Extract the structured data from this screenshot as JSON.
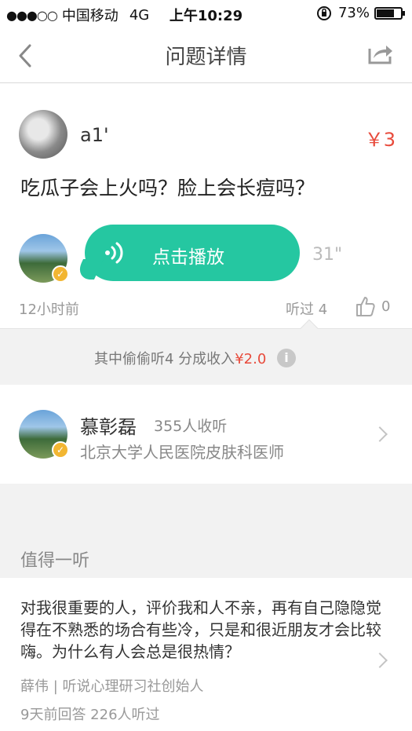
{
  "status_bar": {
    "signal_dots": "●●●○○",
    "carrier": "中国移动",
    "network": "4G",
    "time": "上午10:29",
    "battery_percent": "73%",
    "battery_level": 0.73
  },
  "nav": {
    "title": "问题详情"
  },
  "question": {
    "asker_name": "a1'",
    "price": "￥3",
    "text": "吃瓜子会上火吗？脸上会长痘吗？"
  },
  "answer": {
    "play_label": "点击播放",
    "duration": "31\"",
    "posted": "12小时前",
    "heard": "听过 4",
    "likes": "0"
  },
  "income": {
    "prefix": "其中偷偷听4 分成收入",
    "amount": "¥2.0",
    "info_icon_glyph": "i"
  },
  "doctor": {
    "name": "慕彰磊",
    "listeners": "355人收听",
    "title": "北京大学人民医院皮肤科医师",
    "badge_glyph": "✓"
  },
  "recommended": {
    "heading": "值得一听",
    "items": [
      {
        "question": "对我很重要的人，评价我和人不亲，再有自己隐隐觉得在不熟悉的场合有些冷，只是和很近朋友才会比较嗨。为什么有人会总是很热情？",
        "author": "薛伟 | 听说心理研习社创始人",
        "stats": "9天前回答   226人听过"
      }
    ]
  },
  "colors": {
    "accent_green": "#25c7a1",
    "price_red": "#e84b3c",
    "badge_yellow": "#f2b632"
  }
}
